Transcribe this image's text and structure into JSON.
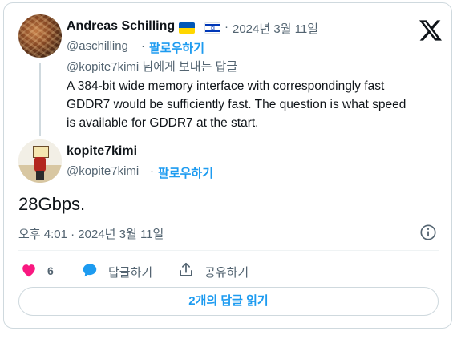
{
  "parent": {
    "name": "Andreas Schilling",
    "flags": [
      "ukraine-flag-icon",
      "israel-flag-icon"
    ],
    "dot": "·",
    "date": "2024년 3월 11일",
    "handle": "@aschilling",
    "follow_sep": "·",
    "follow_label": "팔로우하기",
    "reply_context": "@kopite7kimi 님에게 보내는 답글",
    "text_lines": [
      "A 384-bit wide memory interface with correspondingly fast",
      "GDDR7 would be sufficiently fast. The question is what speed",
      "is available for GDDR7 at the start."
    ]
  },
  "main": {
    "name": "kopite7kimi",
    "handle": "@kopite7kimi",
    "follow_sep": "·",
    "follow_label": "팔로우하기",
    "text": "28Gbps.",
    "timestamp": "오후 4:01 · 2024년 3월 11일"
  },
  "actions": {
    "like_count": "6",
    "reply_label": "답글하기",
    "share_label": "공유하기"
  },
  "read_replies_label": "2개의 답글 읽기",
  "colors": {
    "accent": "#1d9bf0",
    "like": "#f91880",
    "text": "#0f1419",
    "muted": "#536471",
    "border": "#cfd9de"
  },
  "icons": [
    "x-logo-icon",
    "info-icon",
    "heart-icon",
    "reply-bubble-icon",
    "share-icon"
  ]
}
